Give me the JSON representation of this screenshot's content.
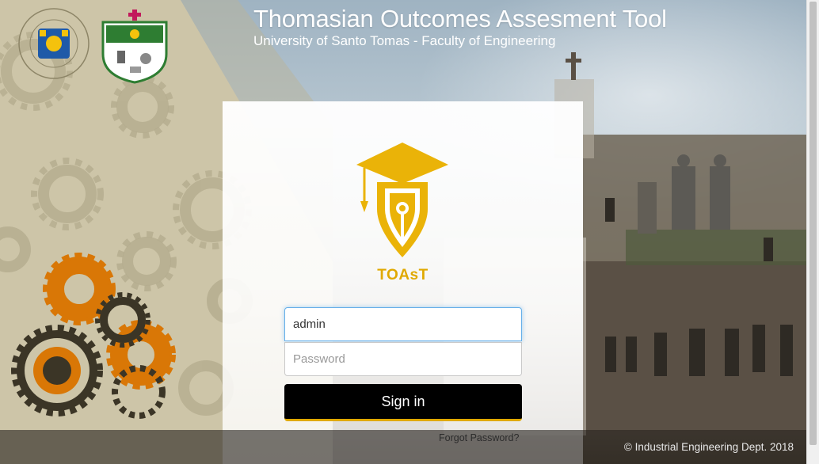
{
  "header": {
    "title": "Thomasian Outcomes Assesment Tool",
    "subtitle": "University of Santo Tomas - Faculty of Engineering"
  },
  "login": {
    "brand": "TOAsT",
    "username_value": "admin",
    "password_placeholder": "Password",
    "signin_label": "Sign in",
    "forgot_label": "Forgot Password?"
  },
  "footer": {
    "copyright": "© Industrial Engineering Dept. 2018"
  },
  "colors": {
    "accent": "#e0a900",
    "gear_orange": "#d97706",
    "gear_dark": "#3b3526"
  }
}
